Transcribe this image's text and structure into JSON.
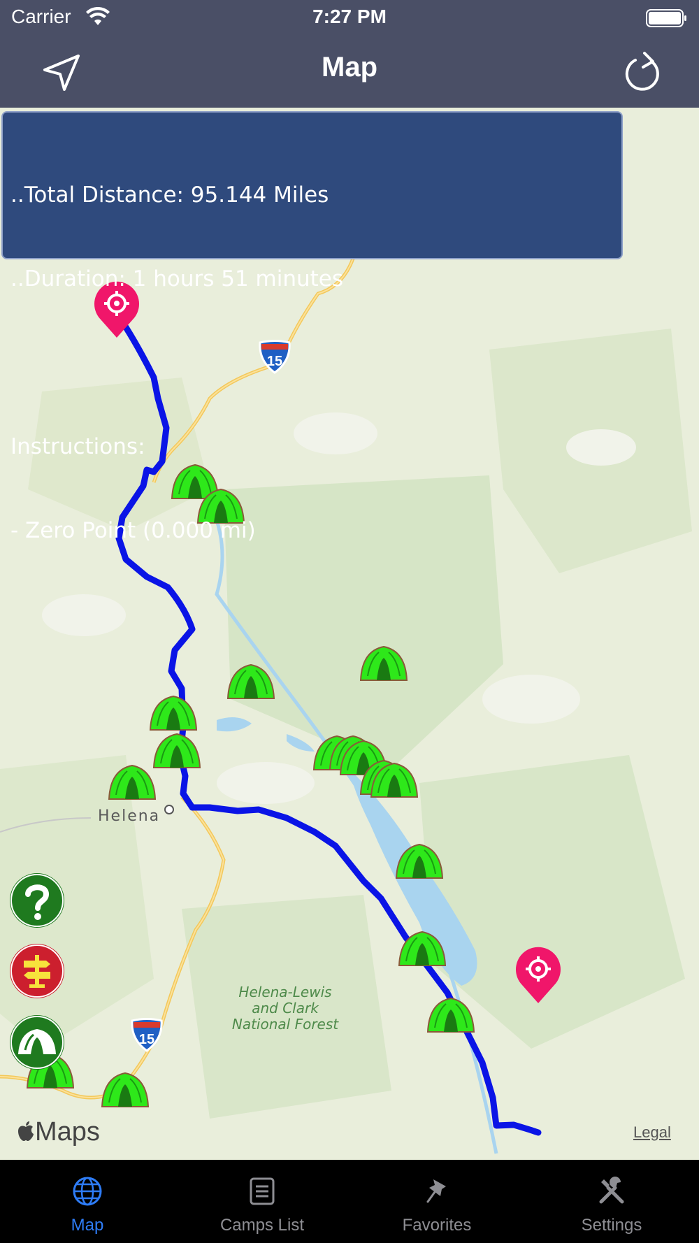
{
  "status_bar": {
    "carrier": "Carrier",
    "time": "7:27 PM"
  },
  "nav": {
    "title": "Map",
    "left_icon": "location-arrow-icon",
    "right_icon": "refresh-icon"
  },
  "route_info": {
    "lines": [
      "..Total Distance: 95.144 Miles",
      "..Duration: 1 hours 51 minutes",
      "",
      "Instructions:",
      "- Zero Point (0.000 mi)"
    ]
  },
  "map": {
    "city_label": "Helena",
    "forest_label": [
      "Helena-Lewis",
      "and Clark",
      "National Forest"
    ],
    "highway_shields": [
      "15",
      "15"
    ],
    "attribution": "Maps",
    "legal": "Legal"
  },
  "side_buttons": [
    {
      "icon": "help-icon",
      "color": "#1f7a1f"
    },
    {
      "icon": "signpost-icon",
      "color": "#cc1f2e"
    },
    {
      "icon": "campsite-icon",
      "color": "#1f7a1f"
    }
  ],
  "tabs": [
    {
      "label": "Map",
      "icon": "globe-icon",
      "active": true
    },
    {
      "label": "Camps List",
      "icon": "list-icon",
      "active": false
    },
    {
      "label": "Favorites",
      "icon": "pushpin-icon",
      "active": false
    },
    {
      "label": "Settings",
      "icon": "tools-icon",
      "active": false
    }
  ],
  "colors": {
    "header": "#4a4f66",
    "panel": "#2f4a7d",
    "route": "#0a14e6",
    "pin": "#f0166a",
    "tent": "#2ee81a",
    "tab_active": "#2e7cf6"
  }
}
